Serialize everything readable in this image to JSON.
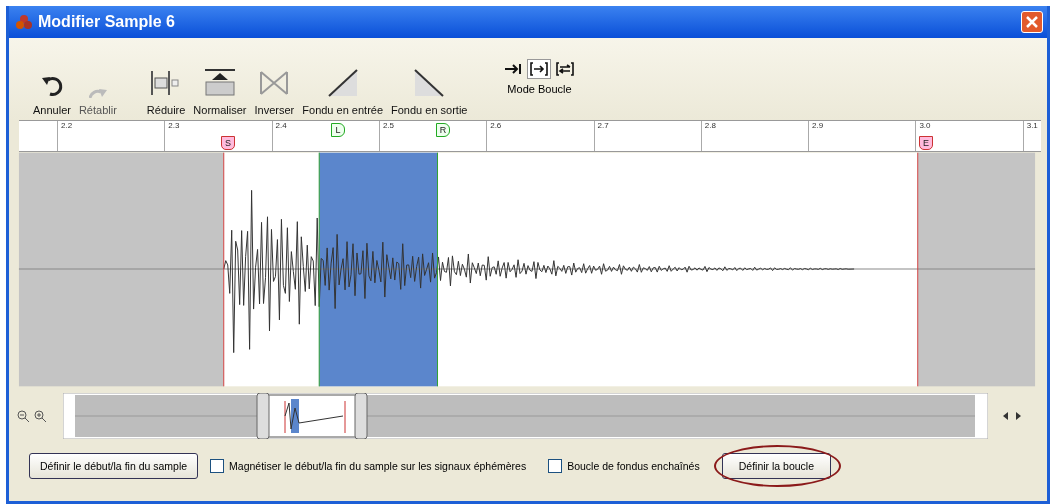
{
  "window": {
    "title": "Modifier Sample 6"
  },
  "toolbar": [
    {
      "label": "Annuler",
      "kind": "undo",
      "disabled": false
    },
    {
      "label": "Rétablir",
      "kind": "redo",
      "disabled": true
    },
    {
      "label": "Réduire",
      "kind": "trim",
      "disabled": false
    },
    {
      "label": "Normaliser",
      "kind": "normalize",
      "disabled": false
    },
    {
      "label": "Inverser",
      "kind": "reverse",
      "disabled": false
    },
    {
      "label": "Fondu en entrée",
      "kind": "fade-in",
      "disabled": false
    },
    {
      "label": "Fondu en sortie",
      "kind": "fade-out",
      "disabled": false
    }
  ],
  "loop_mode": {
    "label": "Mode Boucle",
    "options": [
      {
        "kind": "once",
        "selected": false
      },
      {
        "kind": "forward",
        "selected": true
      },
      {
        "kind": "pingpong",
        "selected": false
      }
    ]
  },
  "ruler": [
    "2.2",
    "2.3",
    "2.4",
    "2.5",
    "2.6",
    "2.7",
    "2.8",
    "2.9",
    "3.0",
    "3.1"
  ],
  "markers": [
    {
      "label": "S",
      "kind": "start"
    },
    {
      "label": "L",
      "kind": "loop-start"
    },
    {
      "label": "R",
      "kind": "loop-end"
    },
    {
      "label": "E",
      "kind": "end"
    }
  ],
  "buttons": {
    "sample_bounds": "Définir le début/la fin du sample",
    "define_loop": "Définir la boucle",
    "define_loop_circled": true
  },
  "checkboxes": [
    {
      "label": "Magnétiser le début/la fin du sample sur les signaux éphémères",
      "checked": false
    },
    {
      "label": "Boucle de fondus enchaînés",
      "checked": false
    }
  ]
}
